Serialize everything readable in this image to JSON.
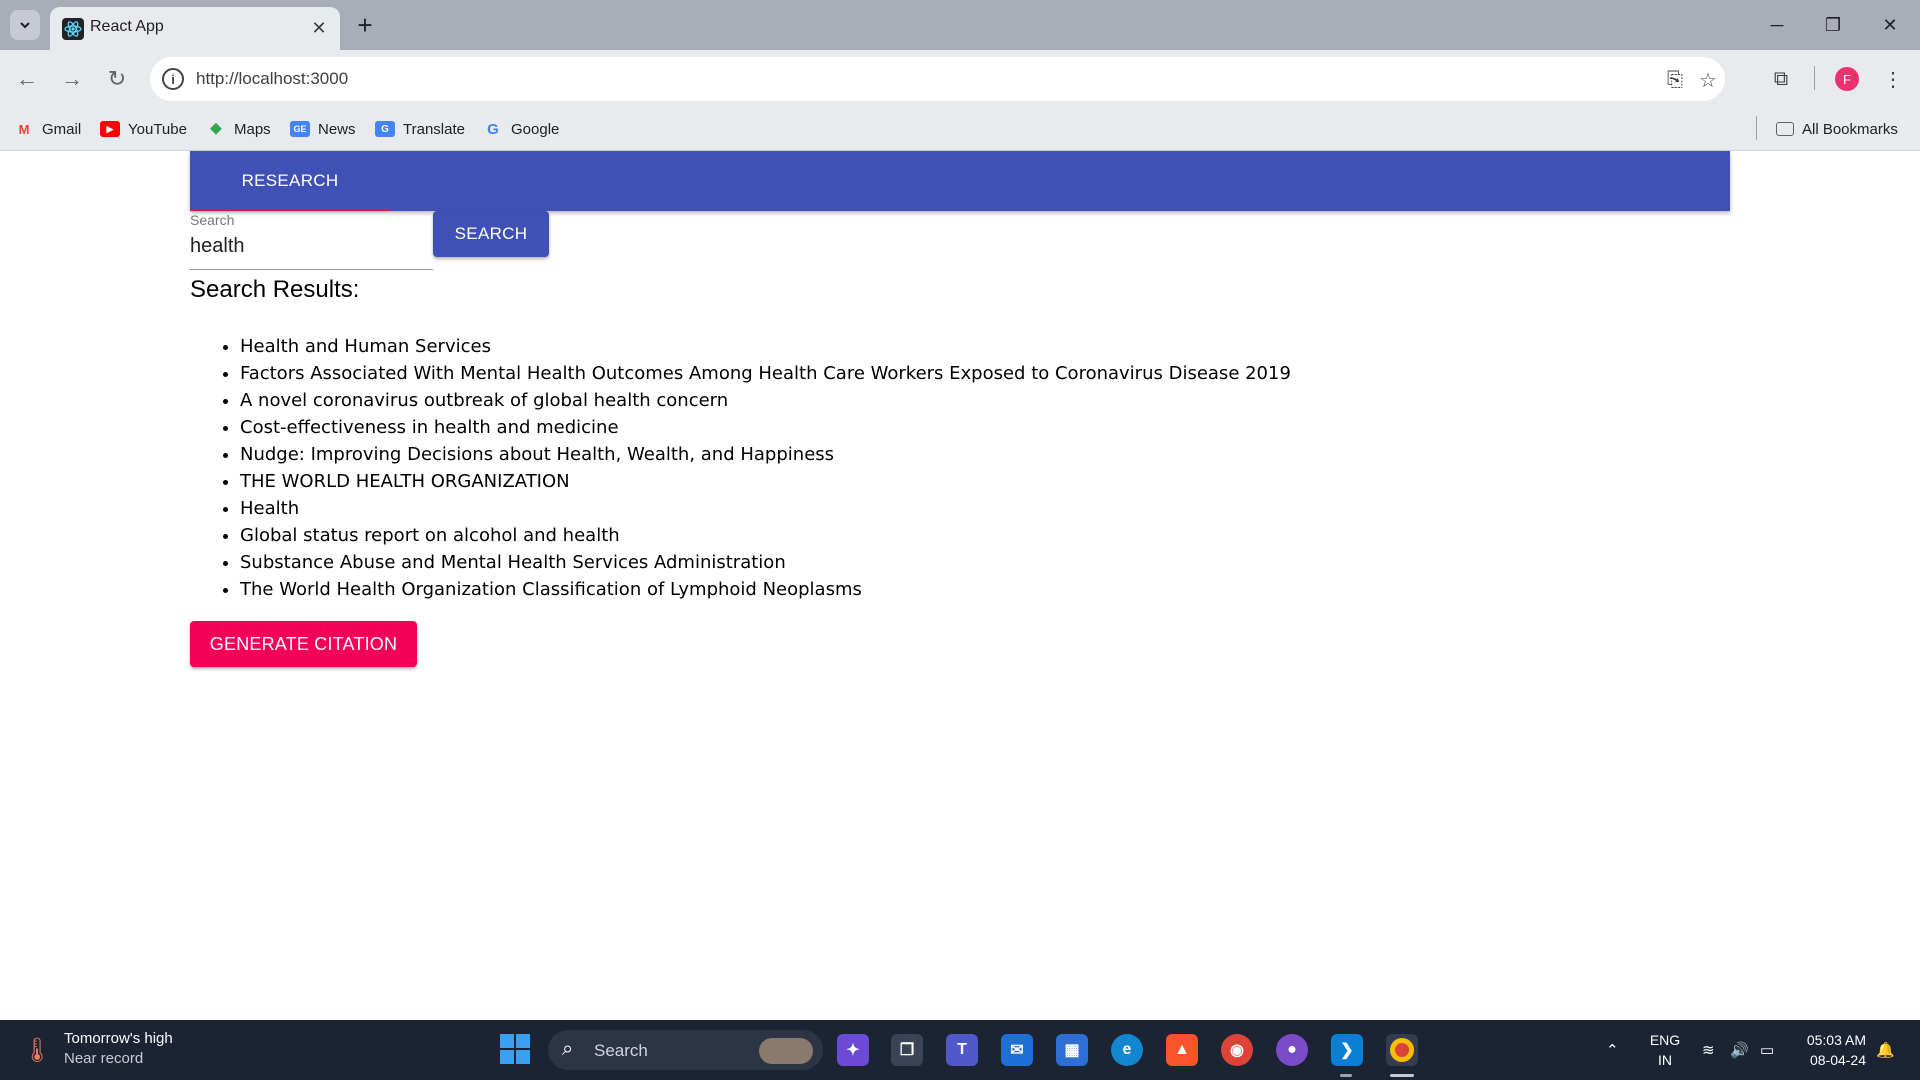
{
  "browser": {
    "tab_title": "React App",
    "url": "http://localhost:3000",
    "profile_initial": "F",
    "bookmarks": [
      {
        "label": "Gmail",
        "icon": "gmail-icon",
        "color": "#ea4335"
      },
      {
        "label": "YouTube",
        "icon": "youtube-icon",
        "color": "#ff0000"
      },
      {
        "label": "Maps",
        "icon": "maps-icon",
        "color": "#34a853"
      },
      {
        "label": "News",
        "icon": "news-icon",
        "color": "#4285f4"
      },
      {
        "label": "Translate",
        "icon": "translate-icon",
        "color": "#4285f4"
      },
      {
        "label": "Google",
        "icon": "google-icon",
        "color": "#4285f4"
      }
    ],
    "all_bookmarks_label": "All Bookmarks"
  },
  "app": {
    "nav_tab_label": "RESEARCH",
    "search_label": "Search",
    "search_value": "health",
    "search_button_label": "SEARCH",
    "results_heading": "Search Results:",
    "results": [
      "Health and Human Services",
      "Factors Associated With Mental Health Outcomes Among Health Care Workers Exposed to Coronavirus Disease 2019",
      "A novel coronavirus outbreak of global health concern",
      "Cost-effectiveness in health and medicine",
      "Nudge: Improving Decisions about Health, Wealth, and Happiness",
      "THE WORLD HEALTH ORGANIZATION",
      "Health",
      "Global status report on alcohol and health",
      "Substance Abuse and Mental Health Services Administration",
      "The World Health Organization Classification of Lymphoid Neoplasms"
    ],
    "generate_button_label": "GENERATE CITATION",
    "colors": {
      "primary": "#3f51b5",
      "secondary": "#f50057"
    }
  },
  "taskbar": {
    "weather_title": "Tomorrow's high",
    "weather_subtitle": "Near record",
    "search_placeholder": "Search",
    "lang_line1": "ENG",
    "lang_line2": "IN",
    "time": "05:03 AM",
    "date": "08-04-24"
  }
}
